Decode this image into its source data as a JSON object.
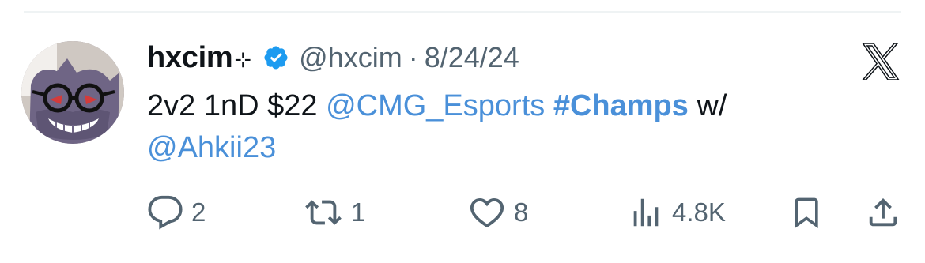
{
  "tweet": {
    "author": {
      "display_name": "hxcim",
      "name_suffix": "⊹",
      "handle": "@hxcim",
      "verified": true
    },
    "separator": "·",
    "date": "8/24/24",
    "text": {
      "part1": "2v2 1nD $22 ",
      "mention1": "@CMG_Esports",
      "space1": " ",
      "hashtag": "#Champs",
      "part2": " w/",
      "mention2": "@Ahkii23"
    },
    "metrics": {
      "replies": "2",
      "reposts": "1",
      "likes": "8",
      "views": "4.8K"
    }
  },
  "icons": {
    "platform_logo": "x-logo-icon",
    "verified": "verified-badge-icon",
    "reply": "reply-icon",
    "repost": "repost-icon",
    "like": "heart-icon",
    "views": "views-icon",
    "bookmark": "bookmark-icon",
    "share": "share-icon"
  },
  "colors": {
    "text": "#0f1419",
    "secondary": "#536471",
    "link": "#4a90d9",
    "verified_blue": "#1d9bf0",
    "divider": "#eff3f4"
  }
}
